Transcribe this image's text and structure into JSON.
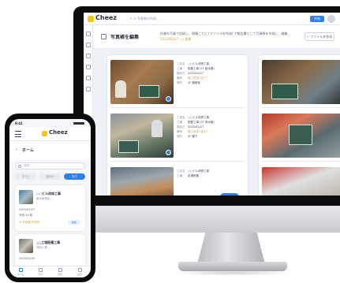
{
  "desktop": {
    "app_name": "Cheez",
    "breadcrumb": "…ト > 写真帳の作成…",
    "top_button_label": "共有",
    "page_title": "写真帳を編集",
    "page_description": "作業を写真で記録し、現場ごとに (ファイルを作成) で報告書として写真帳を作成し、編集…",
    "page_subtext": "2023/02/27 ○○現場",
    "header_button_label": "✓ ファイルを作成",
    "sidebar_icons": [
      "home-icon",
      "camera-icon",
      "folder-icon",
      "users-icon",
      "settings-icon",
      "chart-icon"
    ],
    "cards": [
      {
        "fields": [
          {
            "key": "工事名",
            "value": "○○ビル改修工事"
          },
          {
            "key": "工種",
            "value": "配管工事 (1F 給水管)"
          },
          {
            "key": "撮影日",
            "value": "2023/02/27"
          },
          {
            "key": "備考",
            "value": "施工状況 (完了)"
          },
          {
            "key": "場所",
            "value": "1F 機械室"
          }
        ]
      },
      {
        "fields": [
          {
            "key": "工事名",
            "value": "○○ビル改修工事"
          },
          {
            "key": "工種",
            "value": "配管工事 (2F 排水管)"
          },
          {
            "key": "撮影日",
            "value": "2023/02/27"
          },
          {
            "key": "備考",
            "value": "施工状況 (途中)"
          },
          {
            "key": "場所",
            "value": "2F 廊下"
          }
        ]
      },
      {
        "fields": [
          {
            "key": "工事名",
            "value": "○○ビル改修工事"
          },
          {
            "key": "工種",
            "value": "足場設置"
          }
        ]
      }
    ]
  },
  "phone": {
    "time": "9:41",
    "app_name": "Cheez",
    "section_title": "ホーム",
    "search_placeholder": "検索",
    "tabs": [
      "すべて",
      "進行中",
      "完了"
    ],
    "active_tab": 2,
    "items": [
      {
        "title": "○○ビル改修工事",
        "sub": "東京都港区…",
        "line1": "2023/02/27",
        "line2": "写真 24 枚",
        "tag": "★ 写真帳 作成中",
        "badge": "編集"
      },
      {
        "title": "△△工場設備工事",
        "sub": "神奈川県…",
        "line1": "2023/02/20",
        "line2": "写真 12 枚",
        "tag": "",
        "badge": ""
      }
    ],
    "tabbar": [
      "ホーム",
      "写真",
      "現場",
      "設定"
    ],
    "tabbar_active": 0
  }
}
